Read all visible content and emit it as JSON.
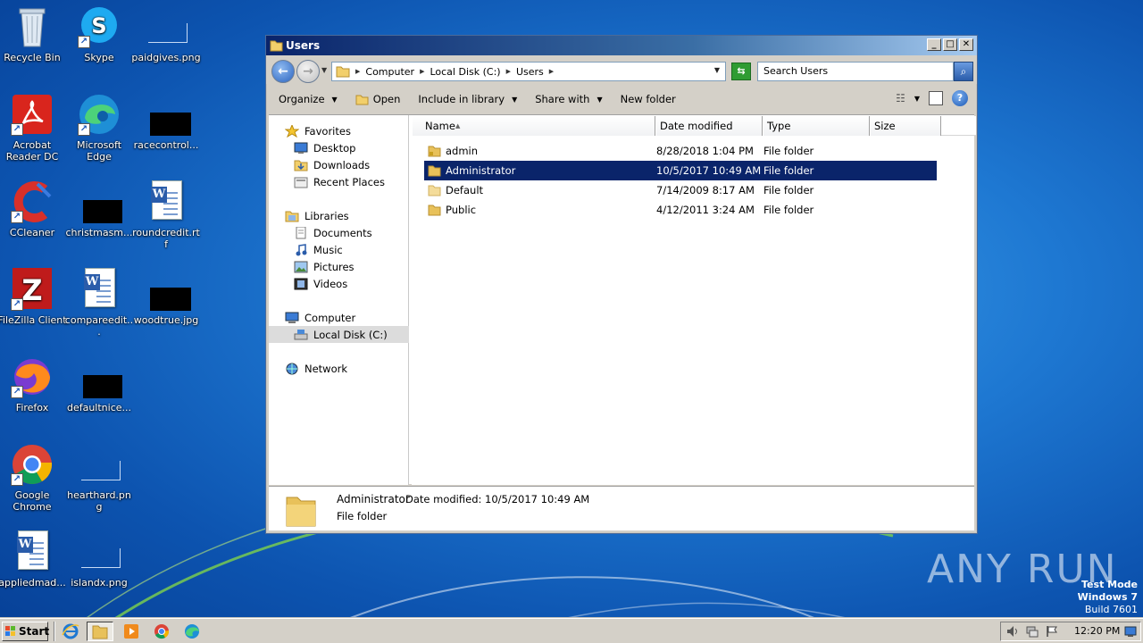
{
  "desktop": {
    "icons": [
      {
        "label": "Recycle Bin"
      },
      {
        "label": "Skype"
      },
      {
        "label": "paidgives.png"
      },
      {
        "label": "Acrobat Reader DC"
      },
      {
        "label": "Microsoft Edge"
      },
      {
        "label": "racecontrol..."
      },
      {
        "label": "CCleaner"
      },
      {
        "label": "christmasm..."
      },
      {
        "label": "roundcredit.rtf"
      },
      {
        "label": "FileZilla Client"
      },
      {
        "label": "compareedit..."
      },
      {
        "label": "woodtrue.jpg"
      },
      {
        "label": "Firefox"
      },
      {
        "label": "defaultnice..."
      },
      {
        "label": "Google Chrome"
      },
      {
        "label": "hearthard.png"
      },
      {
        "label": "appliedmad..."
      },
      {
        "label": "islandx.png"
      }
    ]
  },
  "window": {
    "title": "Users",
    "controls": {
      "minimize": "_",
      "maximize": "□",
      "close": "✕"
    },
    "breadcrumb": [
      "Computer",
      "Local Disk (C:)",
      "Users"
    ],
    "search_placeholder": "Search Users",
    "toolbar": {
      "organize": "Organize",
      "open": "Open",
      "include_in_library": "Include in library",
      "share_with": "Share with",
      "new_folder": "New folder"
    },
    "nav": {
      "favorites": "Favorites",
      "desktop": "Desktop",
      "downloads": "Downloads",
      "recent_places": "Recent Places",
      "libraries": "Libraries",
      "documents": "Documents",
      "music": "Music",
      "pictures": "Pictures",
      "videos": "Videos",
      "computer": "Computer",
      "local_disk": "Local Disk (C:)",
      "network": "Network"
    },
    "columns": {
      "name": "Name",
      "date_modified": "Date modified",
      "type": "Type",
      "size": "Size"
    },
    "files": [
      {
        "name": "admin",
        "date": "8/28/2018 1:04 PM",
        "type": "File folder"
      },
      {
        "name": "Administrator",
        "date": "10/5/2017 10:49 AM",
        "type": "File folder"
      },
      {
        "name": "Default",
        "date": "7/14/2009 8:17 AM",
        "type": "File folder"
      },
      {
        "name": "Public",
        "date": "4/12/2011 3:24 AM",
        "type": "File folder"
      }
    ],
    "details": {
      "name": "Administrator",
      "date": "Date modified: 10/5/2017 10:49 AM",
      "type": "File folder"
    }
  },
  "taskbar": {
    "start_label": "Start",
    "clock": "12:20 PM"
  },
  "watermark": {
    "line1": "Test Mode",
    "line2": "Windows 7",
    "line3": "Build 7601",
    "brand": "ANY RUN"
  },
  "colors": {
    "selection": "#0a246a",
    "titlebar_start": "#0a246a",
    "desktop_bg": "#1e78d2",
    "folder": "#e8c15a"
  }
}
